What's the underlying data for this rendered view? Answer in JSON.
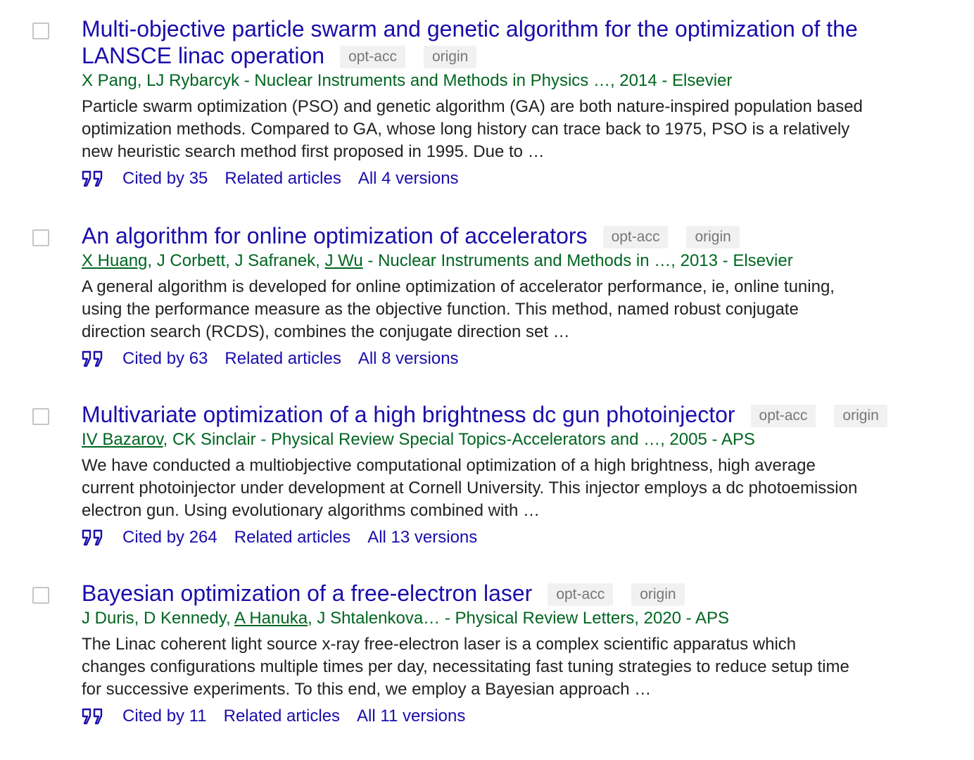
{
  "results": [
    {
      "title_line1": "Multi-objective particle swarm and genetic algorithm for the optimization of the",
      "title_line2": "LANSCE linac operation",
      "tags": [
        "opt-acc",
        "origin"
      ],
      "authors_plain_1": "X Pang, LJ Rybarcyk - Nuclear Instruments and Methods in Physics …, 2014 - Elsevier",
      "snippet": "Particle swarm optimization (PSO) and genetic algorithm (GA) are both nature-inspired population based optimization methods. Compared to GA, whose long history can trace back to 1975, PSO is a relatively new heuristic search method first proposed in 1995. Due to …",
      "cited_by": "Cited by 35",
      "related": "Related articles",
      "versions": "All 4 versions"
    },
    {
      "title_line1": "An algorithm for online optimization of accelerators",
      "tags": [
        "opt-acc",
        "origin"
      ],
      "author_link_1": "X Huang",
      "authors_mid": ", J Corbett, J Safranek, ",
      "author_link_2": "J Wu",
      "authors_rest": " - Nuclear Instruments and Methods in …, 2013 - Elsevier",
      "snippet": "A general algorithm is developed for online optimization of accelerator performance, ie, online tuning, using the performance measure as the objective function. This method, named robust conjugate direction search (RCDS), combines the conjugate direction set …",
      "cited_by": "Cited by 63",
      "related": "Related articles",
      "versions": "All 8 versions"
    },
    {
      "title_line1": "Multivariate optimization of a high brightness dc gun photoinjector",
      "tags": [
        "opt-acc",
        "origin"
      ],
      "author_link_1": "IV Bazarov",
      "authors_rest": ", CK Sinclair - Physical Review Special Topics-Accelerators and …, 2005 - APS",
      "snippet": "We have conducted a multiobjective computational optimization of a high brightness, high average current photoinjector under development at Cornell University. This injector employs a dc photoemission electron gun. Using evolutionary algorithms combined with …",
      "cited_by": "Cited by 264",
      "related": "Related articles",
      "versions": "All 13 versions"
    },
    {
      "title_line1": "Bayesian optimization of a free-electron laser",
      "tags": [
        "opt-acc",
        "origin"
      ],
      "authors_pre": "J Duris, D Kennedy, ",
      "author_link_1": "A Hanuka",
      "authors_rest": ", J Shtalenkova… - Physical Review Letters, 2020 - APS",
      "snippet": "The Linac coherent light source x-ray free-electron laser is a complex scientific apparatus which changes configurations multiple times per day, necessitating fast tuning strategies to reduce setup time for successive experiments. To this end, we employ a Bayesian approach …",
      "cited_by": "Cited by 11",
      "related": "Related articles",
      "versions": "All 11 versions"
    }
  ],
  "icons": {
    "checkbox": "checkbox-empty",
    "cite": "quote-icon"
  },
  "colors": {
    "title": "#1a0dab",
    "authors": "#006621",
    "snippet": "#222222",
    "tag_bg": "#f1f1f1",
    "tag_text": "#777777"
  }
}
